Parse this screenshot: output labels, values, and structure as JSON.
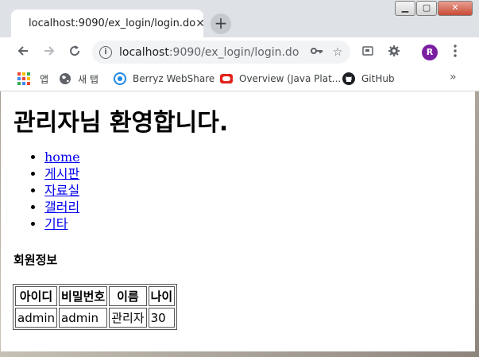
{
  "browser": {
    "tab_title": "localhost:9090/ex_login/login.do",
    "tab_close": "✕",
    "new_tab": "+",
    "url_host": "localhost",
    "url_path": ":9090/ex_login/login.do",
    "profile_initial": "R",
    "window_controls": {
      "minimize": "▁",
      "maximize": "▢",
      "close": "✕"
    }
  },
  "bookmarks": [
    {
      "label": "앱",
      "icon": "apps-grid-icon"
    },
    {
      "label": "새 탭",
      "icon": "globe-icon"
    },
    {
      "label": "Berryz WebShare",
      "icon": "berryz-icon"
    },
    {
      "label": "Overview (Java Plat...",
      "icon": "oracle-icon"
    },
    {
      "label": "GitHub",
      "icon": "github-icon"
    }
  ],
  "bookmarks_more": "»",
  "page": {
    "heading": "관리자님 환영합니다.",
    "menu": [
      "home",
      "게시판",
      "자료실",
      "갤러리",
      "기타"
    ],
    "section_title": "회원정보",
    "table": {
      "headers": [
        "아이디",
        "비밀번호",
        "이름",
        "나이"
      ],
      "rows": [
        [
          "admin",
          "admin",
          "관리자",
          "30"
        ]
      ]
    }
  },
  "colors": {
    "tabstrip": "#dee1e6",
    "link": "#0000ee",
    "avatar": "#7b1fa2"
  }
}
